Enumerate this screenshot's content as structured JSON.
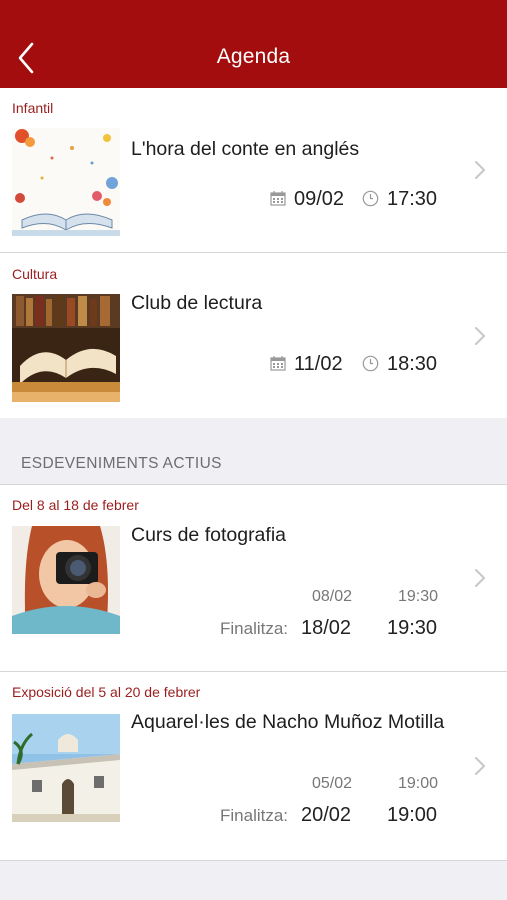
{
  "nav": {
    "title": "Agenda"
  },
  "featured": [
    {
      "category": "Infantil",
      "title": "L'hora del conte en anglés",
      "date": "09/02",
      "time": "17:30"
    },
    {
      "category": "Cultura",
      "title": "Club de lectura",
      "date": "11/02",
      "time": "18:30"
    }
  ],
  "section": {
    "title": "ESDEVENIMENTS ACTIUS"
  },
  "active": [
    {
      "range": "Del 8 al 18 de febrer",
      "title": "Curs de fotografia",
      "start_date": "08/02",
      "start_time": "19:30",
      "end_label": "Finalitza:",
      "end_date": "18/02",
      "end_time": "19:30"
    },
    {
      "range": "Exposició del 5 al 20 de febrer",
      "title": "Aquarel·les de Nacho Muñoz Motilla",
      "start_date": "05/02",
      "start_time": "19:00",
      "end_label": "Finalitza:",
      "end_date": "20/02",
      "end_time": "19:00"
    }
  ],
  "colors": {
    "navbar": "#a30d0d",
    "category": "#9b1e1e",
    "background": "#efeff4"
  }
}
